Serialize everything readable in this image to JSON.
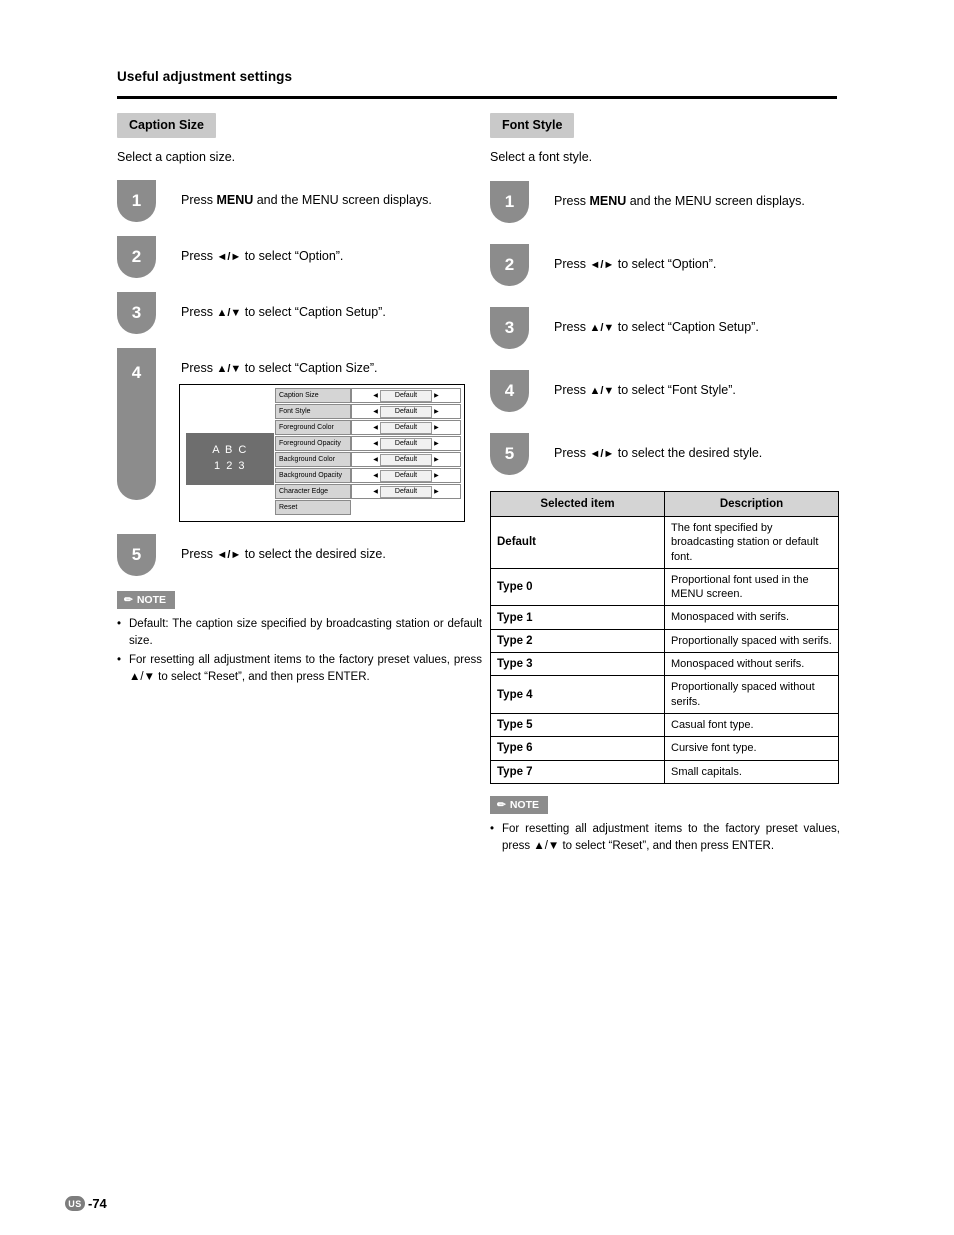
{
  "header": {
    "title": "Useful adjustment settings"
  },
  "left": {
    "section_title": "Caption Size",
    "subtitle": "Select a caption size.",
    "steps": [
      {
        "num": "1",
        "pre": "Press ",
        "bold": "MENU",
        "post": " and the MENU screen displays."
      },
      {
        "num": "2",
        "pre": "Press ",
        "bold": "◄/►",
        "post": " to select “Option”."
      },
      {
        "num": "3",
        "pre": "Press ",
        "bold": "▲/▼",
        "post": " to select “Caption Setup”."
      },
      {
        "num": "4",
        "pre": "Press ",
        "bold": "▲/▼",
        "post": " to select “Caption Size”."
      },
      {
        "num": "5",
        "pre": "Press ",
        "bold": "◄/►",
        "post": " to select the desired size."
      }
    ],
    "osd": {
      "preview_line1": "A B C",
      "preview_line2": "1 2 3",
      "rows": [
        {
          "label": "Caption Size",
          "value": "Default"
        },
        {
          "label": "Font Style",
          "value": "Default"
        },
        {
          "label": "Foreground Color",
          "value": "Default"
        },
        {
          "label": "Foreground Opacity",
          "value": "Default"
        },
        {
          "label": "Background Color",
          "value": "Default"
        },
        {
          "label": "Background Opacity",
          "value": "Default"
        },
        {
          "label": "Character Edge",
          "value": "Default"
        }
      ],
      "reset_label": "Reset"
    },
    "note": {
      "chip": "NOTE",
      "lines": [
        "Default: The caption size specified by broadcasting station or default size.",
        "For resetting all adjustment items to the factory preset values, press ▲/▼ to select “Reset”, and then press ENTER."
      ]
    }
  },
  "right": {
    "section_title": "Font Style",
    "subtitle": "Select a font style.",
    "steps": [
      {
        "num": "1",
        "pre": "Press ",
        "bold": "MENU",
        "post": " and the MENU screen displays."
      },
      {
        "num": "2",
        "pre": "Press ",
        "bold": "◄/►",
        "post": " to select “Option”."
      },
      {
        "num": "3",
        "pre": "Press ",
        "bold": "▲/▼",
        "post": " to select “Caption Setup”."
      },
      {
        "num": "4",
        "pre": "Press ",
        "bold": "▲/▼",
        "post": " to select “Font Style”."
      },
      {
        "num": "5",
        "pre": "Press ",
        "bold": "◄/►",
        "post": " to select the desired style."
      }
    ],
    "table": {
      "headers": [
        "Selected item",
        "Description"
      ],
      "rows": [
        {
          "item": "Default",
          "desc": "The font specified by broadcasting station or default font."
        },
        {
          "item": "Type 0",
          "desc": "Proportional font used in the MENU screen."
        },
        {
          "item": "Type 1",
          "desc": "Monospaced with serifs."
        },
        {
          "item": "Type 2",
          "desc": "Proportionally spaced with serifs."
        },
        {
          "item": "Type 3",
          "desc": "Monospaced without serifs."
        },
        {
          "item": "Type 4",
          "desc": "Proportionally spaced without serifs."
        },
        {
          "item": "Type 5",
          "desc": "Casual font type."
        },
        {
          "item": "Type 6",
          "desc": "Cursive font type."
        },
        {
          "item": "Type 7",
          "desc": "Small capitals."
        }
      ]
    },
    "note": {
      "chip": "NOTE",
      "lines": [
        "For resetting all adjustment items to the factory preset values, press ▲/▼ to select “Reset”, and then press ENTER."
      ]
    }
  },
  "footer": {
    "badge": "US",
    "page": "-74"
  }
}
